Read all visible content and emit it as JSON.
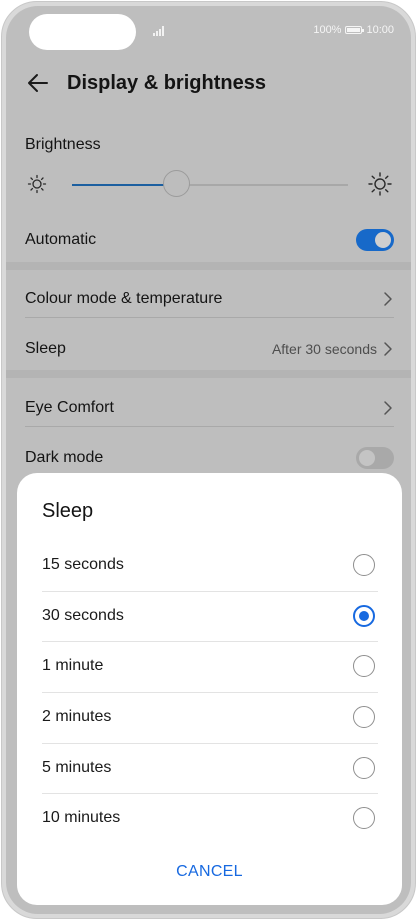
{
  "status_bar": {
    "battery": "100%",
    "time": "10:00"
  },
  "header": {
    "title": "Display & brightness"
  },
  "brightness": {
    "label": "Brightness",
    "level": 0.38
  },
  "automatic": {
    "label": "Automatic",
    "on": true
  },
  "rows": {
    "colour": {
      "label": "Colour mode & temperature"
    },
    "sleep": {
      "label": "Sleep",
      "value": "After 30 seconds"
    },
    "eye": {
      "label": "Eye Comfort"
    },
    "dark": {
      "label": "Dark mode",
      "on": false
    }
  },
  "dialog": {
    "title": "Sleep",
    "options": [
      {
        "label": "15 seconds",
        "selected": false
      },
      {
        "label": "30 seconds",
        "selected": true
      },
      {
        "label": "1 minute",
        "selected": false
      },
      {
        "label": "2 minutes",
        "selected": false
      },
      {
        "label": "5 minutes",
        "selected": false
      },
      {
        "label": "10 minutes",
        "selected": false
      }
    ],
    "cancel_label": "CANCEL"
  },
  "colors": {
    "accent": "#1769e0",
    "toggle_on": "#1769c9",
    "scrim": "#bebebe"
  }
}
